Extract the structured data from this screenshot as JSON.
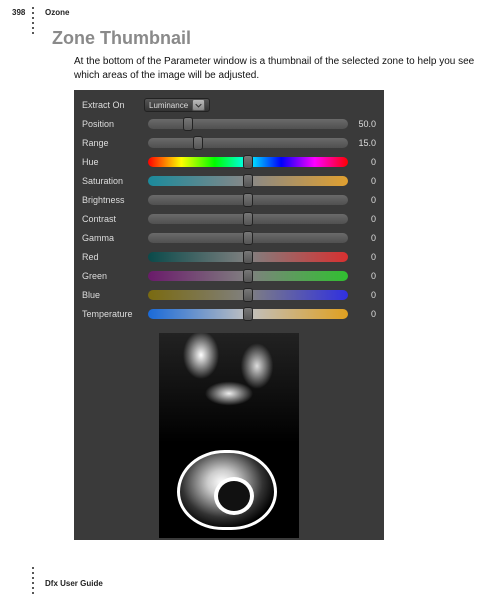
{
  "header": {
    "page_number": "398",
    "section": "Ozone"
  },
  "heading": "Zone Thumbnail",
  "body": "At the bottom of the Parameter window is a thumbnail of the selected zone to help you see which areas of the image will be adjusted.",
  "footer": "Dfx User Guide",
  "panel": {
    "extract_on": {
      "label": "Extract On",
      "value": "Luminance"
    },
    "sliders": [
      {
        "label": "Position",
        "value": "50.0",
        "pos": 20,
        "style": "gray"
      },
      {
        "label": "Range",
        "value": "15.0",
        "pos": 25,
        "style": "gray"
      },
      {
        "label": "Hue",
        "value": "0",
        "pos": 50,
        "style": "hue"
      },
      {
        "label": "Saturation",
        "value": "0",
        "pos": 50,
        "style": "sat"
      },
      {
        "label": "Brightness",
        "value": "0",
        "pos": 50,
        "style": "gray"
      },
      {
        "label": "Contrast",
        "value": "0",
        "pos": 50,
        "style": "gray"
      },
      {
        "label": "Gamma",
        "value": "0",
        "pos": 50,
        "style": "gray"
      },
      {
        "label": "Red",
        "value": "0",
        "pos": 50,
        "style": "red"
      },
      {
        "label": "Green",
        "value": "0",
        "pos": 50,
        "style": "green"
      },
      {
        "label": "Blue",
        "value": "0",
        "pos": 50,
        "style": "blue"
      },
      {
        "label": "Temperature",
        "value": "0",
        "pos": 50,
        "style": "temp"
      }
    ]
  }
}
